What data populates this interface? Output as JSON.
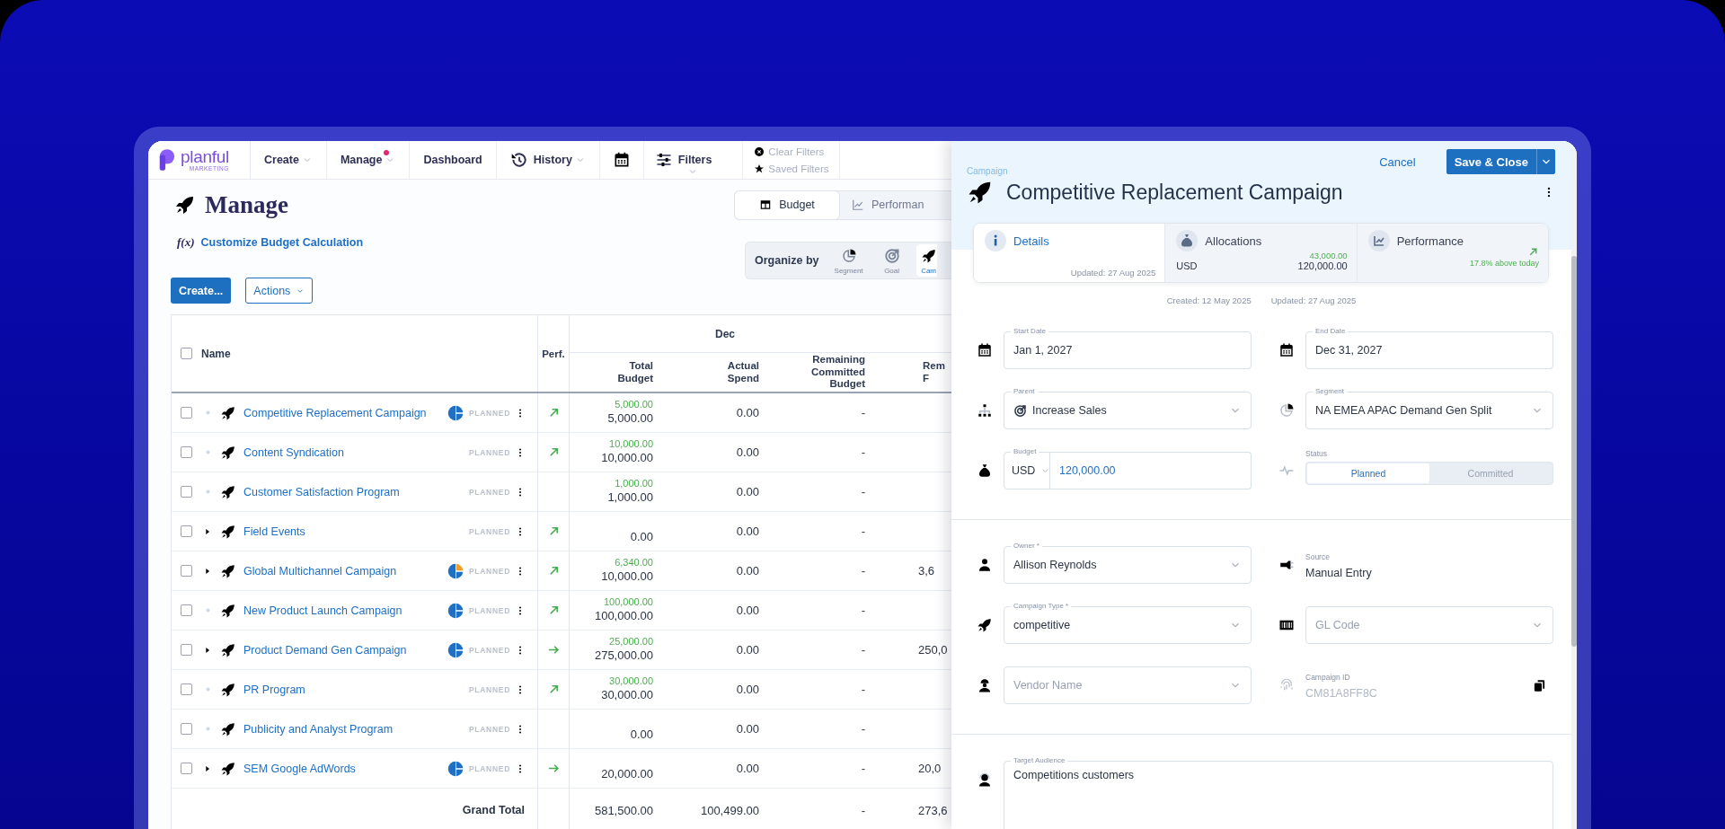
{
  "nav": {
    "logo": {
      "name": "planful",
      "tagline": "MARKETING"
    },
    "items": [
      {
        "kind": "menu",
        "label": "Create",
        "badge": false
      },
      {
        "kind": "menu",
        "label": "Manage",
        "badge": true
      },
      {
        "kind": "link",
        "label": "Dashboard",
        "badge": false
      },
      {
        "kind": "history",
        "label": "History",
        "badge": false
      },
      {
        "kind": "calendar",
        "badge": false
      },
      {
        "kind": "filters",
        "label": "Filters",
        "badge": false
      }
    ],
    "filter_actions": [
      {
        "kind": "clear",
        "label": "Clear Filters",
        "disabled": true
      },
      {
        "kind": "saved",
        "label": "Saved Filters",
        "disabled": true
      }
    ]
  },
  "header": {
    "title": "Manage",
    "views": [
      {
        "kind": "table",
        "label": "Budget",
        "selected": true
      },
      {
        "kind": "chart",
        "label": "Performan",
        "selected": false
      }
    ],
    "formula_link": {
      "icon": "f(x)",
      "label": "Customize Budget Calculation"
    },
    "organize_by": {
      "label": "Organize by",
      "options": [
        {
          "kind": "segment",
          "label": "Segment",
          "selected": false
        },
        {
          "kind": "goal",
          "label": "Goal",
          "selected": false
        },
        {
          "kind": "campaign",
          "label": "Cam",
          "selected": true
        }
      ]
    },
    "create_button": "Create...",
    "actions_button": "Actions"
  },
  "table": {
    "group_header": "Dec",
    "select_all_checked": false,
    "columns": [
      "Name",
      "Perf.",
      "Total Budget",
      "Actual Spend",
      "Remaining Committed Budget",
      "Rem F"
    ],
    "rows": [
      {
        "name": "Competitive Replacement Campaign",
        "checked": false,
        "expandable": false,
        "color": "#1f6fc5",
        "status": "PLANNED",
        "trend_up": true,
        "planned": "5,000.00",
        "total_budget": "5,000.00",
        "actual_spend": "0.00",
        "remaining_committed": "-"
      },
      {
        "name": "Content Syndication",
        "checked": false,
        "expandable": false,
        "status": "PLANNED",
        "trend_up": true,
        "planned": "10,000.00",
        "total_budget": "10,000.00",
        "actual_spend": "0.00",
        "remaining_committed": "-"
      },
      {
        "name": "Customer Satisfaction Program",
        "checked": false,
        "expandable": false,
        "status": "PLANNED",
        "planned": "1,000.00",
        "total_budget": "1,000.00",
        "actual_spend": "0.00",
        "remaining_committed": "-"
      },
      {
        "name": "Field Events",
        "checked": false,
        "expandable": true,
        "status": "PLANNED",
        "trend_up": true,
        "total_budget": "0.00",
        "actual_spend": "0.00",
        "remaining_committed": "-"
      },
      {
        "name": "Global Multichannel Campaign",
        "checked": false,
        "expandable": true,
        "color": "#f59a23",
        "status": "PLANNED",
        "trend_up": true,
        "planned": "6,340.00",
        "total_budget": "10,000.00",
        "actual_spend": "0.00",
        "remaining_committed": "-",
        "column_5": "3,6"
      },
      {
        "name": "New Product Launch Campaign",
        "checked": false,
        "expandable": false,
        "color": "#1f6fc5",
        "status": "PLANNED",
        "trend_up": true,
        "planned": "100,000.00",
        "total_budget": "100,000.00",
        "actual_spend": "0.00",
        "remaining_committed": "-"
      },
      {
        "name": "Product Demand Gen Campaign",
        "checked": false,
        "expandable": true,
        "color": "#1f6fc5",
        "status": "PLANNED",
        "trend_up": false,
        "planned": "25,000.00",
        "total_budget": "275,000.00",
        "actual_spend": "0.00",
        "remaining_committed": "-",
        "column_5": "250,0"
      },
      {
        "name": "PR Program",
        "checked": false,
        "expandable": false,
        "status": "PLANNED",
        "trend_up": true,
        "planned": "30,000.00",
        "total_budget": "30,000.00",
        "actual_spend": "0.00",
        "remaining_committed": "-"
      },
      {
        "name": "Publicity and Analyst Program",
        "checked": false,
        "expandable": false,
        "status": "PLANNED",
        "total_budget": "0.00",
        "actual_spend": "0.00",
        "remaining_committed": "-"
      },
      {
        "name": "SEM Google AdWords",
        "checked": false,
        "expandable": true,
        "color": "#1f6fc5",
        "status": "PLANNED",
        "trend_up": false,
        "total_budget": "20,000.00",
        "actual_spend": "0.00",
        "remaining_committed": "-",
        "column_5": "20,0"
      }
    ],
    "grand_total": {
      "label": "Grand Total",
      "total_budget": "581,500.00",
      "actual_spend": "100,499.00",
      "remaining_committed": "-",
      "column_5": "273,6"
    }
  },
  "panel": {
    "eyebrow": "Campaign",
    "title": "Competitive Replacement Campaign",
    "cancel": "Cancel",
    "save": "Save & Close",
    "tabs": [
      {
        "kind": "details",
        "label": "Details",
        "selected": true,
        "updated": "Updated: 27 Aug 2025"
      },
      {
        "kind": "allocations",
        "label": "Allocations",
        "selected": false,
        "currency": "USD",
        "planned": "43,000.00",
        "amount": "120,000.00"
      },
      {
        "kind": "performance",
        "label": "Performance",
        "selected": false,
        "trend_up": true,
        "note": "17.8% above today"
      }
    ],
    "created": "Created: 12 May 2025",
    "updated": "Updated: 27 Aug 2025",
    "sections": [
      {
        "fields": [
          {
            "kind": "text",
            "label": "Start Date",
            "value": "Jan 1, 2027"
          },
          {
            "kind": "text",
            "label": "End Date",
            "value": "Dec 31, 2027"
          },
          {
            "kind": "goal_select",
            "label": "Parent",
            "value": "Increase Sales"
          },
          {
            "kind": "select",
            "label": "Segment",
            "value": "NA EMEA APAC Demand Gen Split"
          },
          {
            "kind": "currency",
            "label": "Budget",
            "currency": "USD",
            "value": "120,000.00"
          },
          {
            "kind": "toggle",
            "label": "Status",
            "options": [
              {
                "label": "Planned",
                "selected": true
              },
              {
                "label": "Committed",
                "selected": false
              }
            ]
          }
        ]
      },
      {
        "fields": [
          {
            "kind": "select",
            "label": "Owner *",
            "value": "Allison Reynolds"
          },
          {
            "kind": "static",
            "label": "Source",
            "value": "Manual Entry"
          },
          {
            "kind": "select",
            "label": "Campaign Type *",
            "value": "competitive"
          },
          {
            "kind": "select",
            "placeholder": "GL Code"
          },
          {
            "kind": "select",
            "placeholder": "Vendor Name"
          },
          {
            "kind": "id",
            "label": "Campaign ID",
            "value": "CM81A8FF8C"
          }
        ]
      },
      {
        "fields": [
          {
            "kind": "textarea",
            "label": "Target Audience",
            "value": "Competitions customers"
          }
        ]
      }
    ]
  }
}
